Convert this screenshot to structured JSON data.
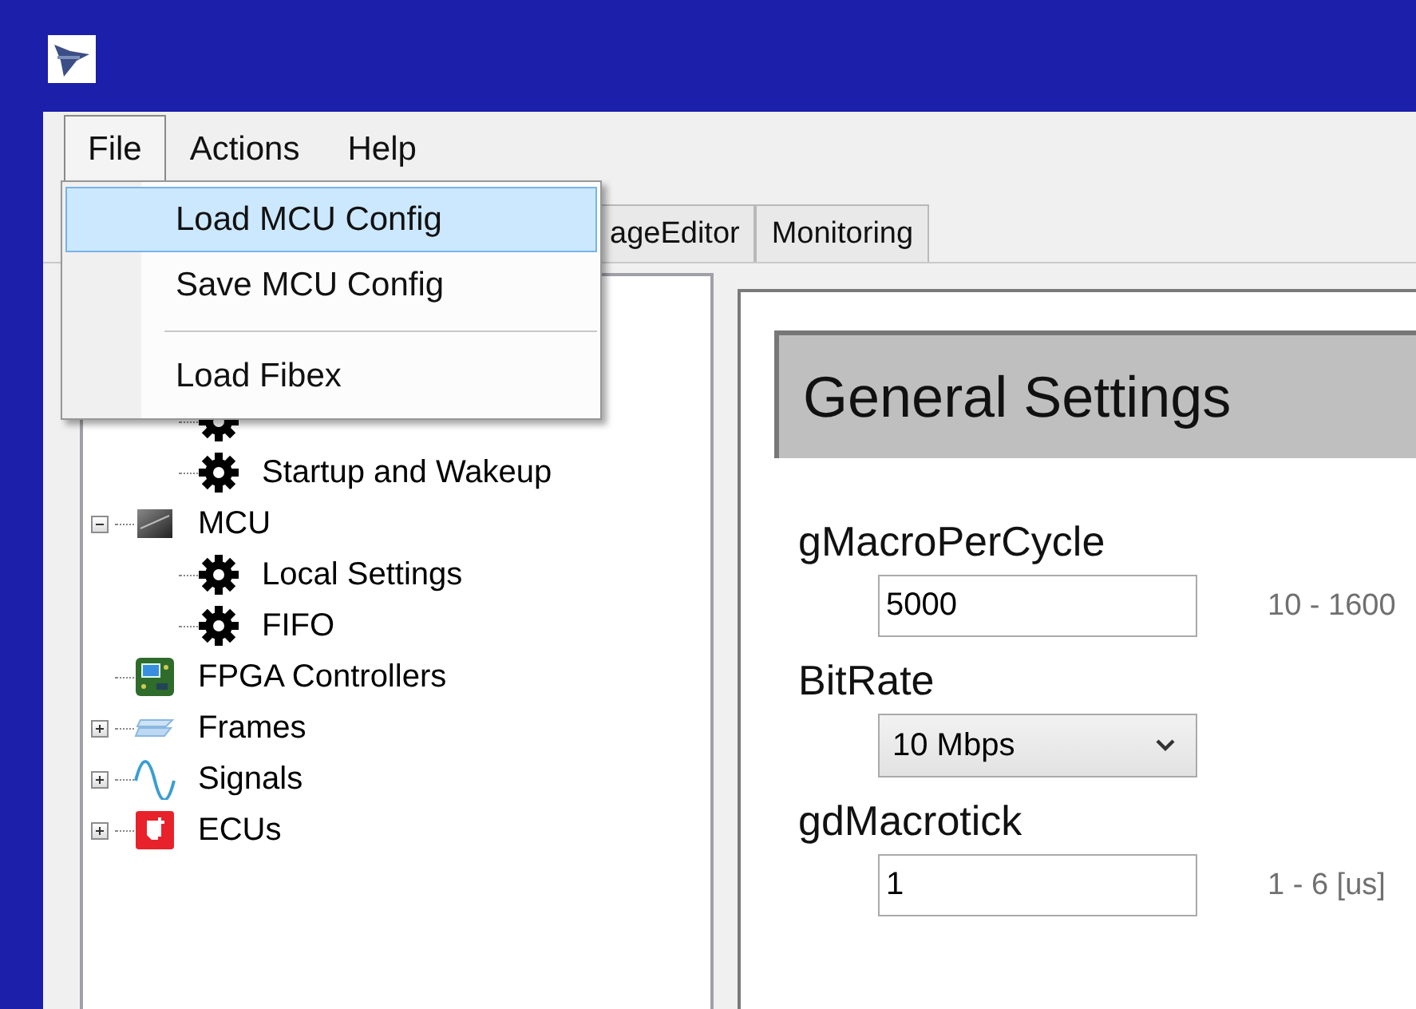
{
  "menubar": {
    "items": [
      {
        "label": "File",
        "selected": true
      },
      {
        "label": "Actions",
        "selected": false
      },
      {
        "label": "Help",
        "selected": false
      }
    ]
  },
  "file_menu": {
    "items": [
      {
        "kind": "item",
        "label": "Load MCU Config",
        "selected": true
      },
      {
        "kind": "item",
        "label": "Save MCU Config",
        "selected": false
      },
      {
        "kind": "separator"
      },
      {
        "kind": "item",
        "label": "Load Fibex",
        "selected": false
      }
    ]
  },
  "tabs": [
    {
      "label": "ageEditor",
      "selected": false
    },
    {
      "label": "Monitoring",
      "selected": false
    }
  ],
  "tree": {
    "items": [
      {
        "children": [
          {
            "kind": "gear"
          },
          {
            "label": "Startup and Wakeup",
            "kind": "gear"
          }
        ]
      },
      {
        "label": "MCU",
        "kind": "chip",
        "expanded": true,
        "children": [
          {
            "label": "Local Settings",
            "kind": "gear"
          },
          {
            "label": "FIFO",
            "kind": "gear"
          }
        ]
      },
      {
        "label": "FPGA Controllers",
        "kind": "board"
      },
      {
        "label": "Frames",
        "kind": "frames",
        "expanded": false
      },
      {
        "label": "Signals",
        "kind": "wave",
        "expanded": false
      },
      {
        "label": "ECUs",
        "kind": "ecu",
        "expanded": false
      }
    ]
  },
  "settings": {
    "title": "General Settings",
    "fields": [
      {
        "kind": "text",
        "label": "gMacroPerCycle",
        "value": "5000",
        "hint": "10 - 1600"
      },
      {
        "kind": "dropdown",
        "label": "BitRate",
        "value": "10 Mbps"
      },
      {
        "kind": "text",
        "label": "gdMacrotick",
        "value": "1",
        "hint": "1 - 6 [us]"
      }
    ]
  }
}
